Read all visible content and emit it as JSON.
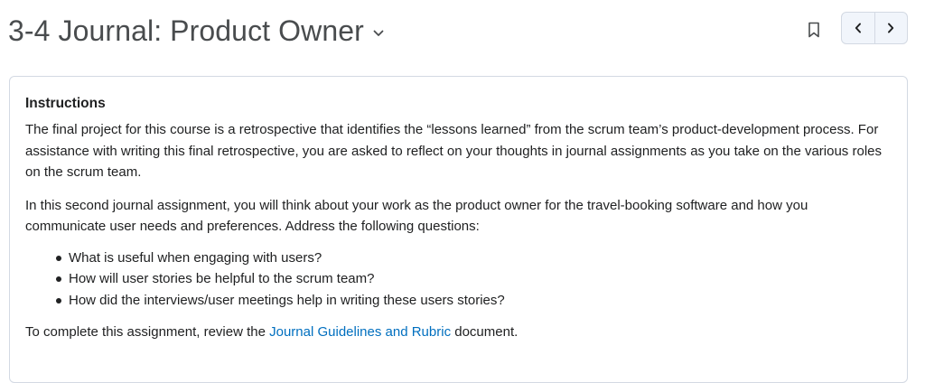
{
  "header": {
    "title": "3-4 Journal: Product Owner",
    "dropdown_icon": "chevron-down-icon",
    "bookmark_icon": "bookmark-icon",
    "prev_icon": "chevron-left-icon",
    "next_icon": "chevron-right-icon"
  },
  "content": {
    "heading": "Instructions",
    "paragraph1": "The final project for this course is a retrospective that identifies the “lessons learned” from the scrum team’s product-development process. For assistance with writing this final retrospective, you are asked to reflect on your thoughts in journal assignments as you take on the various roles on the scrum team.",
    "paragraph2": "In this second journal assignment, you will think about your work as the product owner for the travel-booking software and how you communicate user needs and preferences. Address the following questions:",
    "questions": [
      "What is useful when engaging with users?",
      "How will user stories be helpful to the scrum team?",
      "How did the interviews/user meetings help in writing these users stories?"
    ],
    "closing_before": "To complete this assignment, review the ",
    "closing_link": "Journal Guidelines and Rubric",
    "closing_after": " document."
  },
  "colors": {
    "title": "#494c4e",
    "text": "#202122",
    "link": "#006fbf",
    "border": "#d3d9e3",
    "nav_bg": "#f1f5fb"
  }
}
